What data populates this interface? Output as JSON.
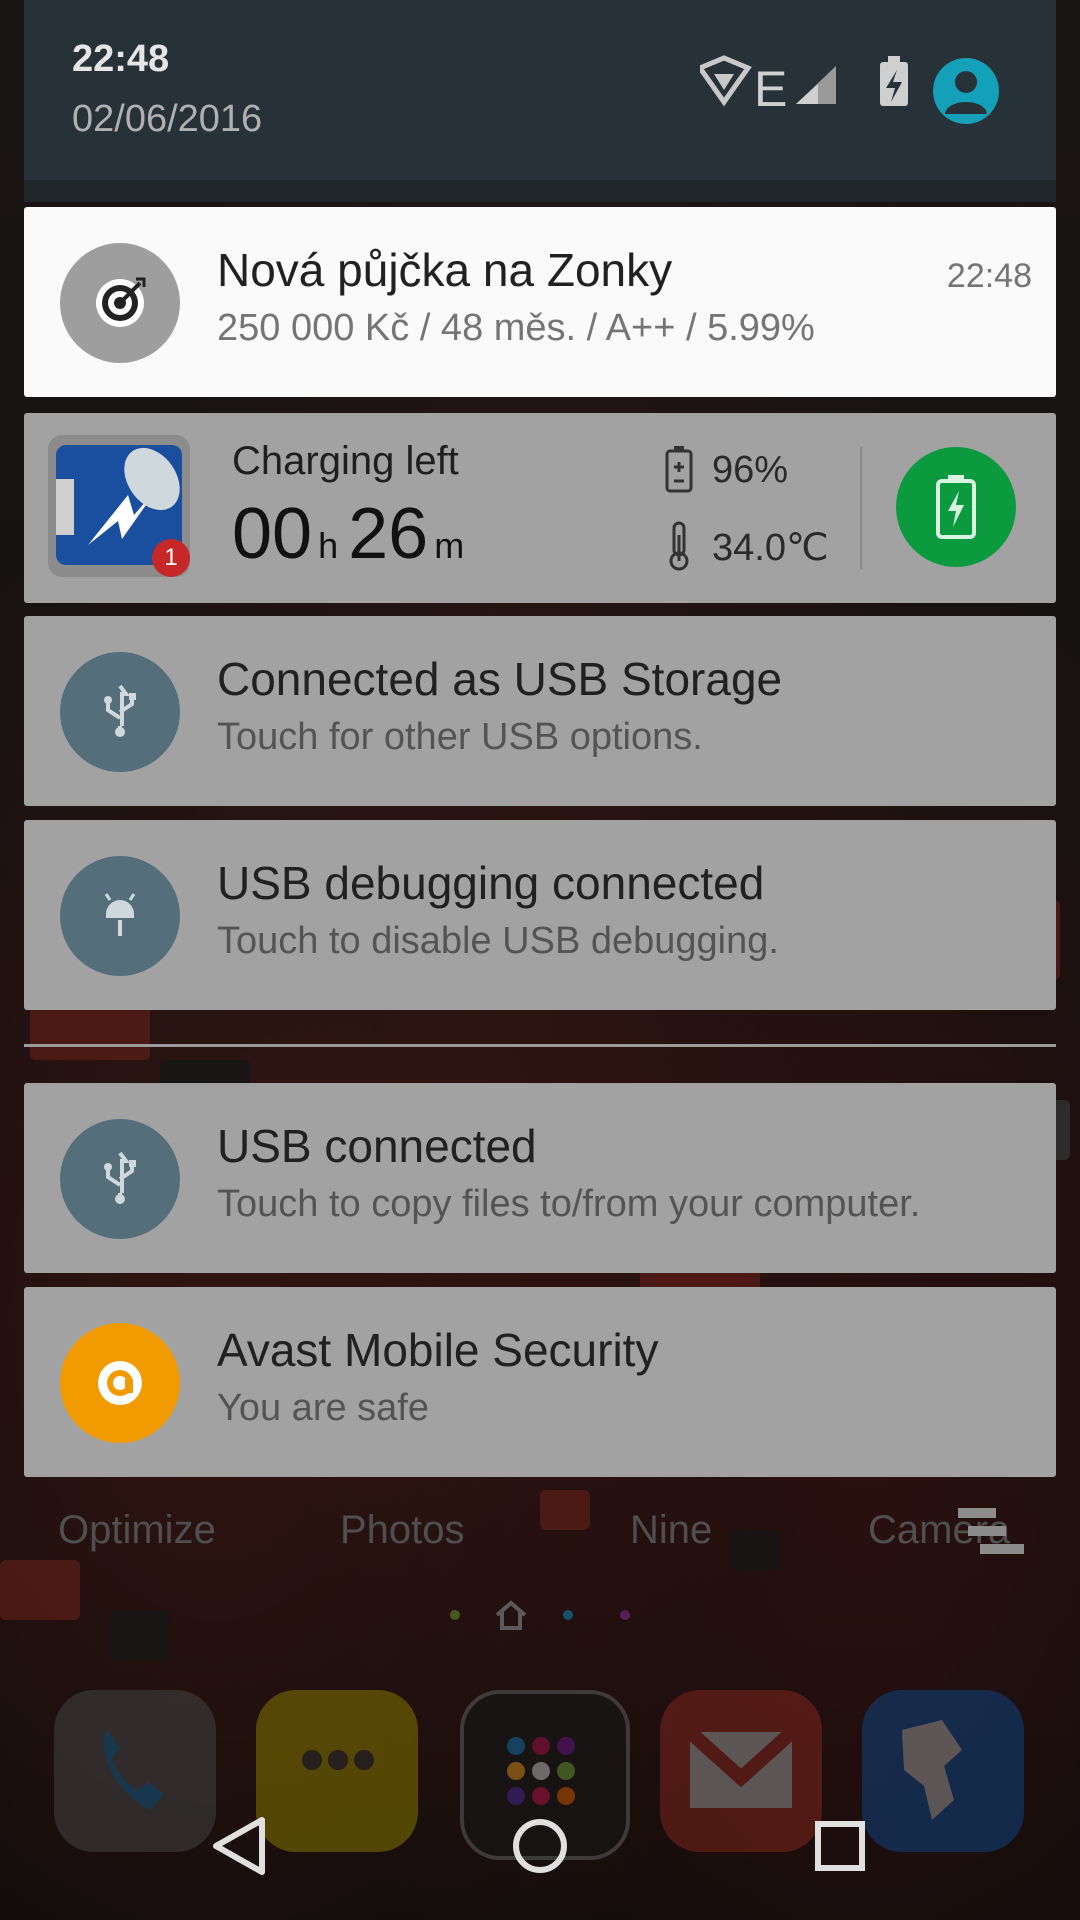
{
  "status": {
    "time": "22:48",
    "date": "02/06/2016",
    "network_type": "E"
  },
  "notifications": [
    {
      "app": "Zonky",
      "icon": "target-icon",
      "title": "Nová půjčka na Zonky",
      "text": "250 000 Kč / 48 měs. / A++ / 5.99%",
      "time": "22:48",
      "color": "#9e9e9e"
    },
    {
      "icon": "usb-icon",
      "title": "Connected as USB Storage",
      "text": "Touch for other USB options.",
      "color": "#546e7a"
    },
    {
      "icon": "android-debug-icon",
      "title": "USB debugging connected",
      "text": "Touch to disable USB debugging.",
      "color": "#546e7a"
    },
    {
      "icon": "usb-icon",
      "title": "USB connected",
      "text": "Touch to copy files to/from your computer.",
      "color": "#546e7a"
    },
    {
      "icon": "avast-icon",
      "title": "Avast Mobile Security",
      "text": "You are safe",
      "color": "#f29b00"
    }
  ],
  "charging": {
    "label": "Charging left",
    "hours": "00",
    "hours_unit": "h",
    "minutes": "26",
    "minutes_unit": "m",
    "battery_percent": "96%",
    "temperature": "34.0℃",
    "badge_count": "1",
    "button_color": "#0c9a3e"
  },
  "home_screen": {
    "labels": [
      "Optimize",
      "Photos",
      "Nine",
      "Camera"
    ]
  }
}
